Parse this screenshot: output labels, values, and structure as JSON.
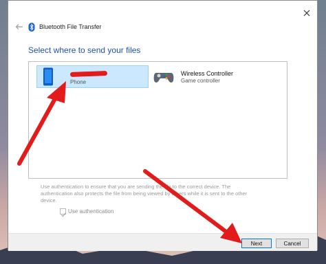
{
  "window": {
    "title": "Bluetooth File Transfer",
    "heading": "Select where to send your files"
  },
  "devices": [
    {
      "name": "",
      "type": "Phone",
      "icon": "phone-icon",
      "selected": true
    },
    {
      "name": "Wireless Controller",
      "type": "Game controller",
      "icon": "gamepad-icon",
      "selected": false
    }
  ],
  "auth": {
    "description": "Use authentication to ensure that you are sending the file to the correct device. The authentication also protects the file from being viewed by others while it is sent to the other device.",
    "checkbox_label": "Use authentication",
    "checked": true
  },
  "buttons": {
    "next": "Next",
    "cancel": "Cancel"
  },
  "colors": {
    "accent": "#0078d7",
    "heading": "#1f4fb0",
    "selection": "#cce8ff",
    "annotation": "#e21b1b"
  }
}
